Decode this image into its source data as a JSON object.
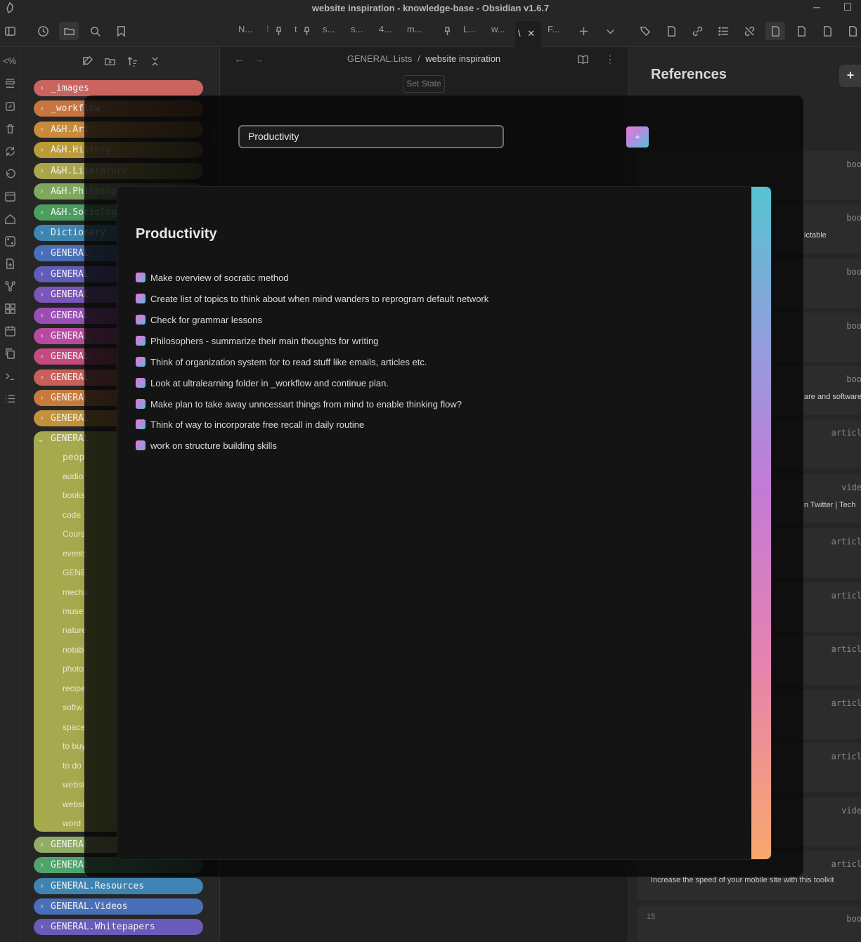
{
  "window": {
    "title": "website inspiration - knowledge-base - Obsidian v1.6.7",
    "minimize": "─",
    "maximize": "☐"
  },
  "tabs": [
    "N...",
    "t",
    "s...",
    "s...",
    "4...",
    "m...",
    "L...",
    "w...",
    "F..."
  ],
  "active_tab": "\\",
  "breadcrumb": {
    "parent": "GENERAL.Lists",
    "separator": "/",
    "current": "website inspiration"
  },
  "set_state_label": "Set State",
  "ribbon_label": "<%",
  "explorer": {
    "folders": [
      {
        "label": "_images",
        "color": "#c9645f"
      },
      {
        "label": "_workflow",
        "color": "#c97540"
      },
      {
        "label": "A&H.Art",
        "color": "#c98a3a"
      },
      {
        "label": "A&H.History",
        "color": "#bb9a38"
      },
      {
        "label": "A&H.Literature",
        "color": "#a9a54a"
      },
      {
        "label": "A&H.Philosophy",
        "color": "#7da85e"
      },
      {
        "label": "A&H.Sociology",
        "color": "#4a9e5e"
      },
      {
        "label": "Dictionary",
        "color": "#3d86b2"
      },
      {
        "label": "GENERAL",
        "color": "#4a6fb9"
      },
      {
        "label": "GENERAL",
        "color": "#5f5cba"
      },
      {
        "label": "GENERAL",
        "color": "#7b55b8"
      },
      {
        "label": "GENERAL",
        "color": "#9a4fb5"
      },
      {
        "label": "GENERAL",
        "color": "#b84aa2"
      },
      {
        "label": "GENERAL",
        "color": "#c44a7f"
      },
      {
        "label": "GENERAL",
        "color": "#c8605a"
      },
      {
        "label": "GENERAL",
        "color": "#c87a3c"
      },
      {
        "label": "GENERAL",
        "color": "#c2923a"
      }
    ],
    "open_folder": "GENERAL",
    "subitems": [
      "peop",
      "audio",
      "books",
      "code",
      "Cours",
      "events",
      "GENE",
      "mecha",
      "muse",
      "nature",
      "notab",
      "photo",
      "recipe",
      "softw",
      "space",
      "to buy",
      "to do",
      "websi",
      "websi",
      "word"
    ],
    "bottom_folders": [
      {
        "label": "GENERAL",
        "color": "#8fae63"
      },
      {
        "label": "GENERAL",
        "color": "#4ea46b"
      },
      {
        "label": "GENERAL.Resources",
        "color": "#3d84b2"
      },
      {
        "label": "GENERAL.Videos",
        "color": "#4a6fb9"
      },
      {
        "label": "GENERAL.Whitepapers",
        "color": "#6a5ab9"
      }
    ]
  },
  "references": {
    "title": "References",
    "add_label": "+",
    "cards": [
      {
        "type": "boo",
        "text": ""
      },
      {
        "type": "boo",
        "text": "ictable"
      },
      {
        "type": "boo",
        "text": ""
      },
      {
        "type": "boo",
        "text": ""
      },
      {
        "type": "boo",
        "text": "are and software"
      },
      {
        "type": "articl",
        "text": ""
      },
      {
        "type": "vide",
        "text": "n Twitter | Tech"
      },
      {
        "type": "articl",
        "text": ""
      },
      {
        "type": "articl",
        "text": ""
      },
      {
        "type": "articl",
        "text": ""
      },
      {
        "type": "articl",
        "text": ""
      },
      {
        "type": "articl",
        "text": ""
      },
      {
        "type": "vide",
        "text": ""
      },
      {
        "type": "articl",
        "text": "Increase the speed of your mobile site with this toolkit"
      },
      {
        "type": "boo",
        "text": "15"
      }
    ]
  },
  "modal": {
    "search_value": "Productivity",
    "add_button": "+",
    "card_title": "Productivity",
    "tasks": [
      "Make overview of socratic method",
      "Create list of topics to think about when mind wanders to reprogram default network",
      "Check for grammar lessons",
      "Philosophers - summarize their main thoughts for writing",
      "Think of organization system for to read stuff like emails, articles etc.",
      "Look at ultralearning folder in _workflow and continue plan.",
      "Make plan to take away unncessart things from mind to enable thinking flow?",
      "Think of way to incorporate free recall in daily routine",
      "work on structure building skills"
    ]
  }
}
